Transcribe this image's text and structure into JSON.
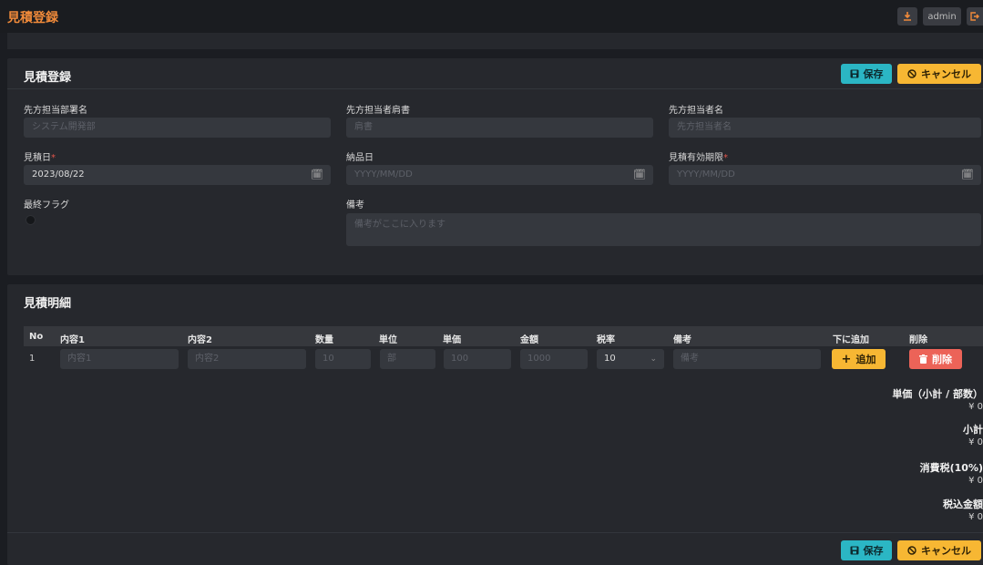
{
  "app": {
    "title": "見積登録"
  },
  "topbar": {
    "user": "admin"
  },
  "form": {
    "title": "見積登録",
    "save_label": "保存",
    "cancel_label": "キャンセル",
    "fields": {
      "dept": {
        "label": "先方担当部署名",
        "placeholder": "システム開発部"
      },
      "position": {
        "label": "先方担当者肩書",
        "placeholder": "肩書"
      },
      "person": {
        "label": "先方担当者名",
        "placeholder": "先方担当者名"
      },
      "date": {
        "label": "見積日",
        "required": "*",
        "value": "2023/08/22"
      },
      "delivery": {
        "label": "納品日",
        "placeholder": "YYYY/MM/DD"
      },
      "expiry": {
        "label": "見積有効期限",
        "required": "*",
        "placeholder": "YYYY/MM/DD"
      },
      "final_flag": {
        "label": "最終フラグ",
        "value": false
      },
      "remarks": {
        "label": "備考",
        "placeholder": "備考がここに入ります"
      }
    }
  },
  "details": {
    "title": "見積明細",
    "columns": [
      "No",
      "内容1",
      "内容2",
      "数量",
      "単位",
      "単価",
      "金額",
      "税率",
      "備考",
      "下に追加",
      "削除"
    ],
    "rows": [
      {
        "no": "1",
        "content1_placeholder": "内容1",
        "content2_placeholder": "内容2",
        "qty_placeholder": "10",
        "unit_placeholder": "部",
        "price_placeholder": "100",
        "amount_placeholder": "1000",
        "tax_rate": "10",
        "remarks_placeholder": "備考"
      }
    ],
    "add_label": "追加",
    "delete_label": "削除",
    "summary": [
      {
        "label": "単価（小計 / 部数）",
        "value": "¥ 0"
      },
      {
        "label": "小計",
        "value": "¥ 0"
      },
      {
        "label": "消費税(10%)",
        "value": "¥ 0"
      },
      {
        "label": "税込金額",
        "value": "¥ 0"
      }
    ],
    "save_label": "保存",
    "cancel_label": "キャンセル"
  },
  "colors": {
    "accent": "#f08a3a",
    "save": "#2bb6c4",
    "cancel": "#f7b733",
    "delete": "#ec6358"
  },
  "icons": [
    "download-icon",
    "logout-icon",
    "save-icon",
    "cancel-icon",
    "calendar-icon",
    "chevron-down-icon",
    "plus-icon",
    "trash-icon"
  ]
}
